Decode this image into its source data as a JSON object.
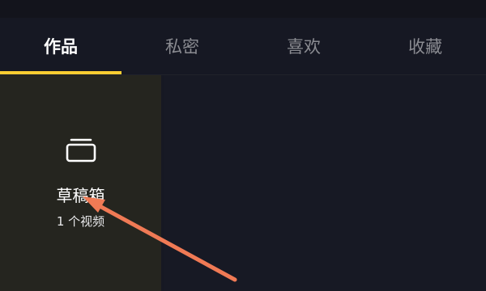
{
  "tabs": [
    {
      "label": "作品",
      "active": true
    },
    {
      "label": "私密",
      "active": false
    },
    {
      "label": "喜欢",
      "active": false
    },
    {
      "label": "收藏",
      "active": false
    }
  ],
  "draft": {
    "title": "草稿箱",
    "count": "1 个视频",
    "icon": "drafts-box-icon"
  },
  "colors": {
    "background": "#161823",
    "tab_indicator": "#facd32",
    "tab_active": "#ffffff",
    "tab_inactive": "#8a8b91",
    "annotation_arrow": "#f07a55"
  }
}
